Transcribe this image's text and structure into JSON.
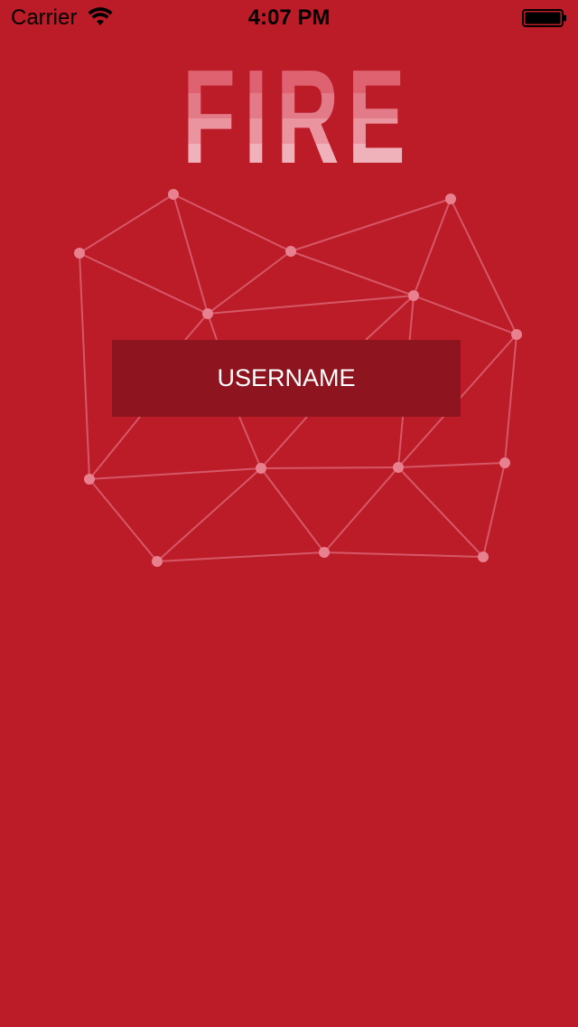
{
  "status_bar": {
    "carrier": "Carrier",
    "time": "4:07 PM",
    "wifi_icon": "wifi-icon",
    "battery_icon": "battery-icon"
  },
  "logo": {
    "text": "FIRE"
  },
  "login": {
    "username_label": "USERNAME"
  },
  "colors": {
    "background": "#bc1b28",
    "button_background": "#8e1420",
    "network_node": "#e8808f",
    "network_line": "#e8808f"
  }
}
